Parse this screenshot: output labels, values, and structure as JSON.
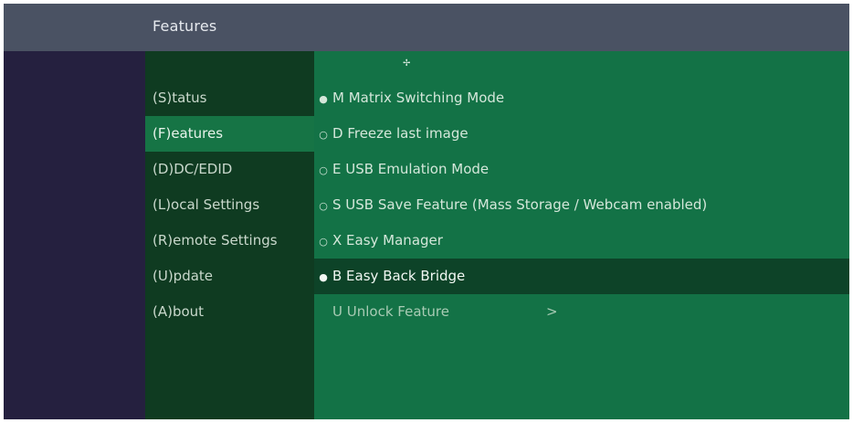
{
  "header": {
    "title": "Features"
  },
  "menu": {
    "items": [
      {
        "label": "(S)tatus"
      },
      {
        "label": "(F)eatures"
      },
      {
        "label": "(D)DC/EDID"
      },
      {
        "label": "(L)ocal Settings"
      },
      {
        "label": "(R)emote Settings"
      },
      {
        "label": "(U)pdate"
      },
      {
        "label": "(A)bout"
      }
    ],
    "selected_index": 1
  },
  "features": {
    "cursor": "✢",
    "items": [
      {
        "bullet": "●",
        "label": "M Matrix Switching Mode"
      },
      {
        "bullet": "○",
        "label": "D Freeze last image"
      },
      {
        "bullet": "○",
        "label": "E USB Emulation Mode"
      },
      {
        "bullet": "○",
        "label": "S USB Save Feature (Mass Storage / Webcam enabled)"
      },
      {
        "bullet": "○",
        "label": "X Easy Manager"
      },
      {
        "bullet": "●",
        "label": "B Easy Back Bridge"
      }
    ],
    "highlighted_index": 5,
    "unlock": {
      "label": "U Unlock Feature",
      "arrow": ">"
    }
  },
  "colors": {
    "header_bg": "#4a5263",
    "frame_bg": "#25203f",
    "menu_bg": "#0f3b21",
    "menu_selected_bg": "#167445",
    "content_bg": "#137246",
    "content_highlight_bg": "#0d4328"
  }
}
